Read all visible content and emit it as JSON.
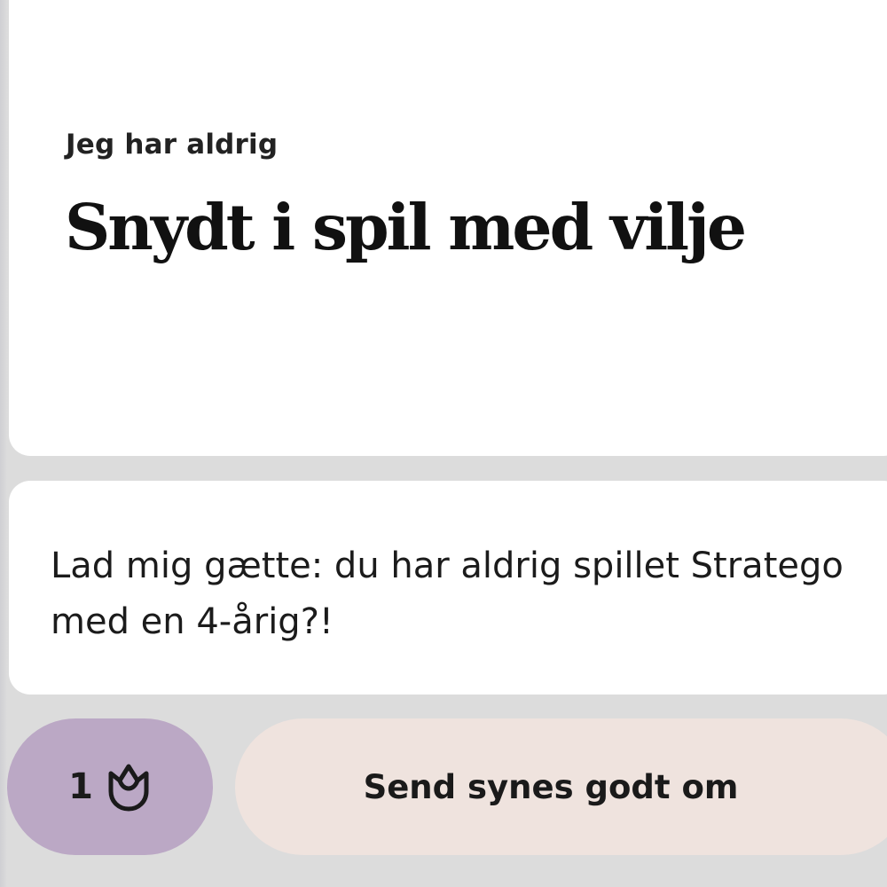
{
  "prompt": {
    "label": "Jeg har aldrig",
    "statement": "Snydt i spil med vilje"
  },
  "answer": {
    "text": "Lad mig gætte: du har aldrig spillet Stratego med en 4-årig?!"
  },
  "actions": {
    "like_count": "1",
    "like_icon": "tulip-icon",
    "send_label": "Send synes godt om"
  },
  "colors": {
    "background": "#dcdcdc",
    "card": "#ffffff",
    "like_pill": "#bba8c5",
    "send_pill": "#efe3de"
  }
}
